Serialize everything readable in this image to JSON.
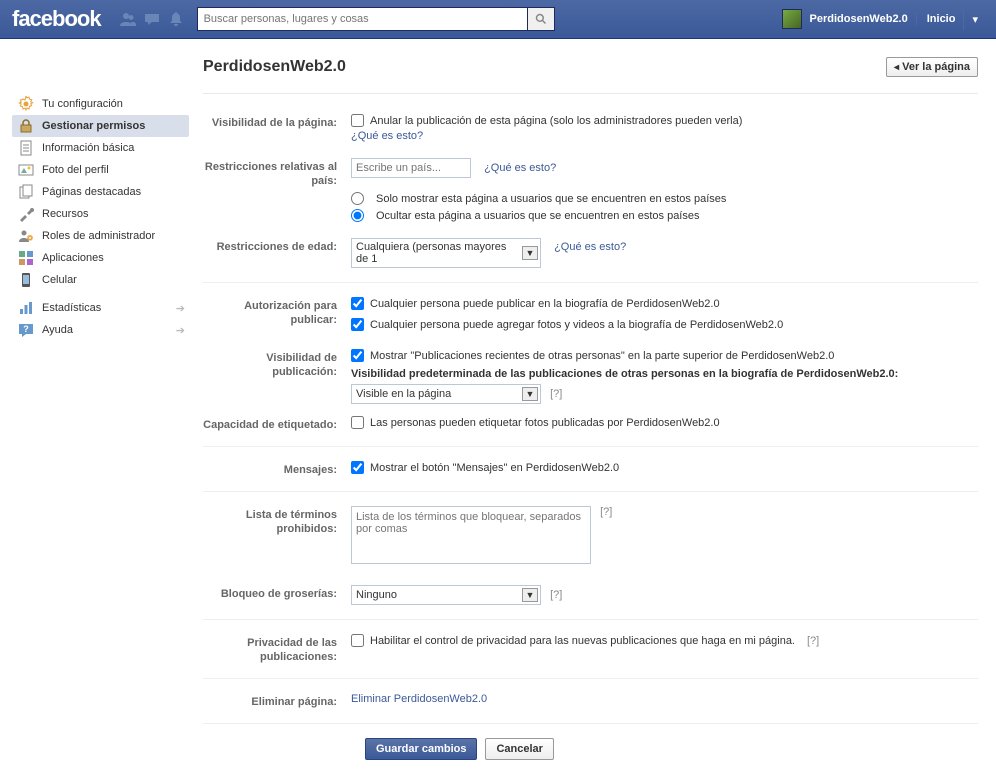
{
  "topbar": {
    "search_placeholder": "Buscar personas, lugares y cosas",
    "username": "PerdidosenWeb2.0",
    "home": "Inicio"
  },
  "sidebar": {
    "items": [
      {
        "label": "Tu configuración"
      },
      {
        "label": "Gestionar permisos"
      },
      {
        "label": "Información básica"
      },
      {
        "label": "Foto del perfil"
      },
      {
        "label": "Páginas destacadas"
      },
      {
        "label": "Recursos"
      },
      {
        "label": "Roles de administrador"
      },
      {
        "label": "Aplicaciones"
      },
      {
        "label": "Celular"
      },
      {
        "label": "Estadísticas"
      },
      {
        "label": "Ayuda"
      }
    ]
  },
  "main": {
    "title": "PerdidosenWeb2.0",
    "view_page": "Ver la página",
    "labels": {
      "visibility": "Visibilidad de la página:",
      "country": "Restricciones relativas al país:",
      "age": "Restricciones de edad:",
      "post_auth": "Autorización para publicar:",
      "post_vis": "Visibilidad de publicación:",
      "tagging": "Capacidad de etiquetado:",
      "messages": "Mensajes:",
      "blocked_terms": "Lista de términos prohibidos:",
      "profanity": "Bloqueo de groserías:",
      "post_privacy": "Privacidad de las publicaciones:",
      "delete": "Eliminar página:"
    },
    "fields": {
      "visibility_chk": "Anular la publicación de esta página (solo los administradores pueden verla)",
      "what_is_this": "¿Qué es esto?",
      "country_placeholder": "Escribe un país...",
      "country_opt1": "Solo mostrar esta página a usuarios que se encuentren en estos países",
      "country_opt2": "Ocultar esta página a usuarios que se encuentren en estos países",
      "age_value": "Cualquiera (personas mayores de 1",
      "post_auth1": "Cualquier persona puede publicar en la biografía de PerdidosenWeb2.0",
      "post_auth2": "Cualquier persona puede agregar fotos y videos a la biografía de PerdidosenWeb2.0",
      "post_vis1": "Mostrar \"Publicaciones recientes de otras personas\" en la parte superior de PerdidosenWeb2.0",
      "post_vis_note": "Visibilidad predeterminada de las publicaciones de otras personas en la biografía de PerdidosenWeb2.0:",
      "post_vis_select": "Visible en la página",
      "tagging_chk": "Las personas pueden etiquetar fotos publicadas por PerdidosenWeb2.0",
      "messages_chk": "Mostrar el botón \"Mensajes\" en PerdidosenWeb2.0",
      "blocked_placeholder": "Lista de los términos que bloquear, separados por comas",
      "profanity_value": "Ninguno",
      "post_privacy_chk": "Habilitar el control de privacidad para las nuevas publicaciones que haga en mi página.",
      "delete_link": "Eliminar PerdidosenWeb2.0",
      "q": "[?]"
    },
    "buttons": {
      "save": "Guardar cambios",
      "cancel": "Cancelar"
    }
  }
}
